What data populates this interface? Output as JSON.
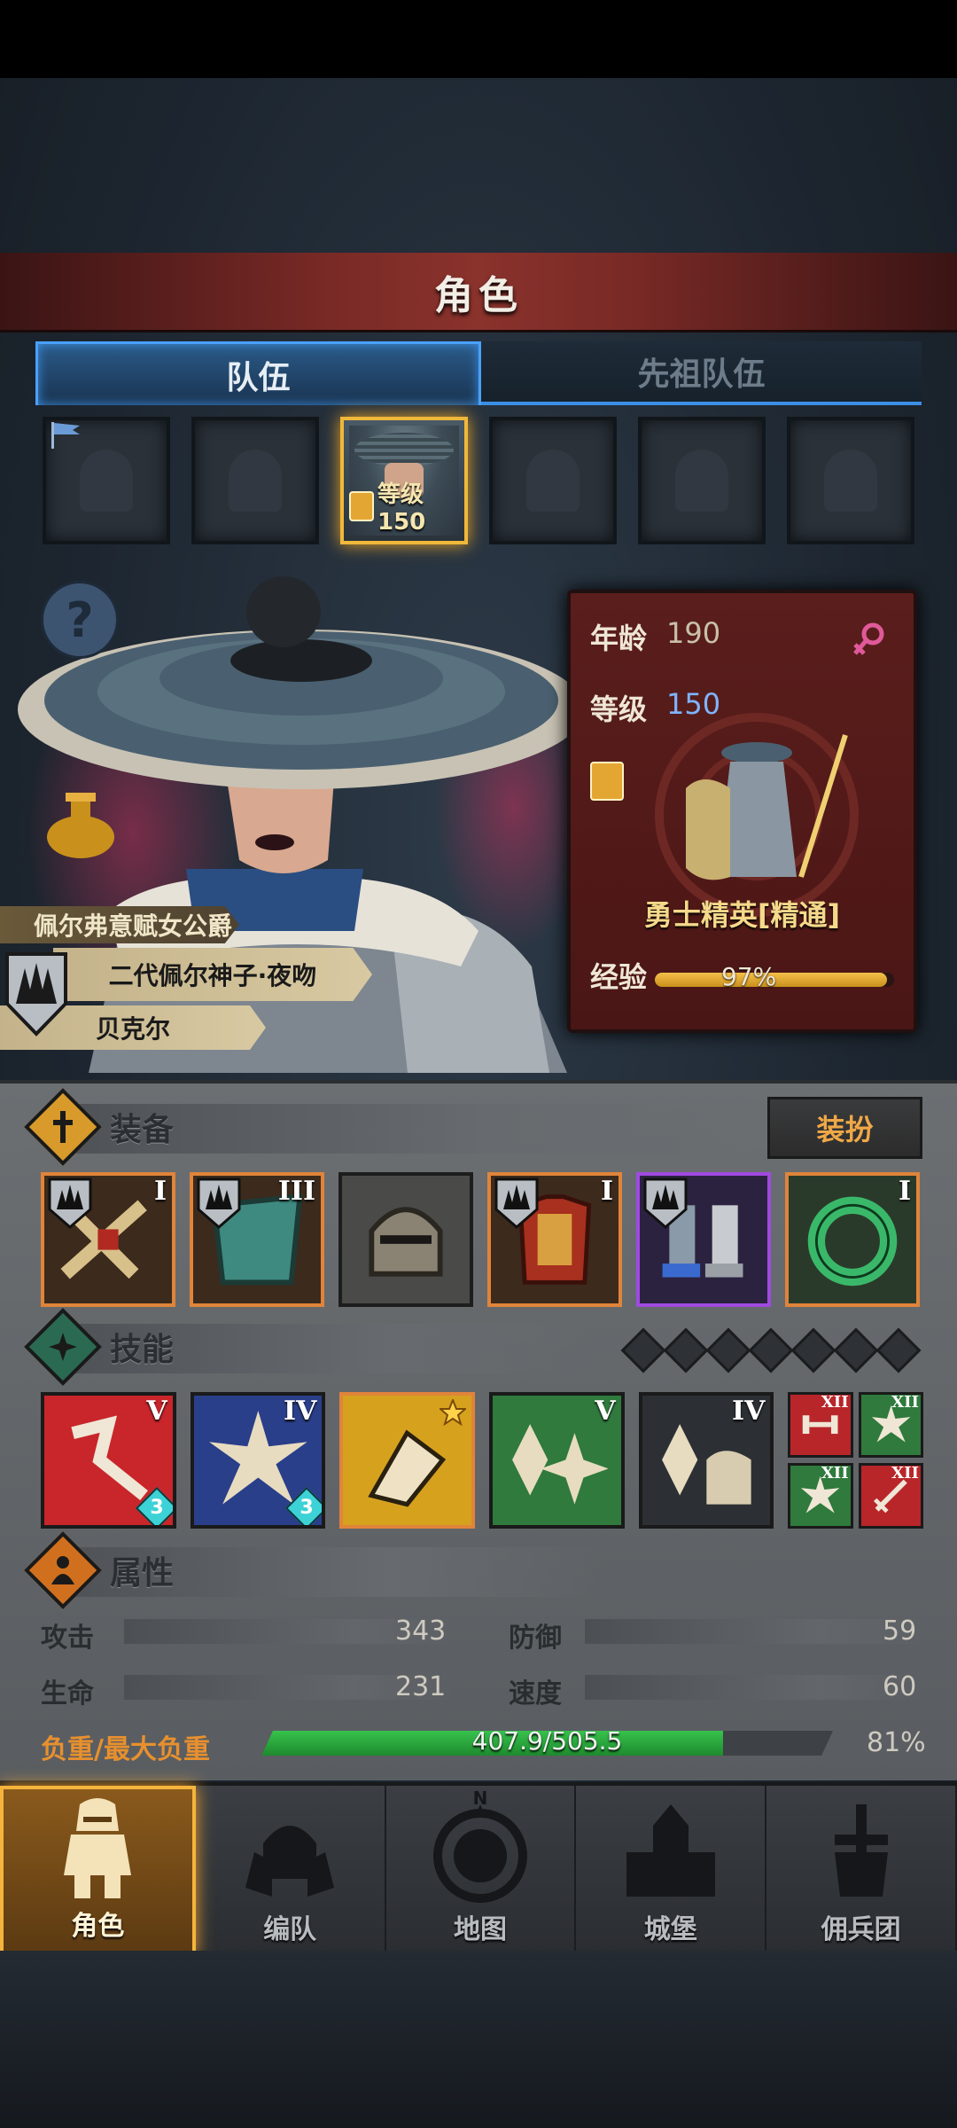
{
  "header": {
    "title": "角色"
  },
  "tabs": [
    {
      "label": "队伍",
      "active": true
    },
    {
      "label": "先祖队伍",
      "active": false
    }
  ],
  "team": {
    "selected_slot": 3,
    "selected_level_label": "等级150"
  },
  "hero": {
    "title": "佩尔弗意赋女公爵",
    "epithet": "二代佩尔神子·夜吻",
    "name": "贝克尔",
    "age_label": "年龄",
    "age": "190",
    "level_label": "等级",
    "level": "150",
    "class_name": "勇士精英[精通]",
    "exp_label": "经验",
    "exp_pct_text": "97%",
    "exp_fraction": 0.97
  },
  "equipment": {
    "title": "装备",
    "dress_button": "装扮",
    "items": [
      {
        "name": "weapon",
        "tier": "I",
        "rarity": "orange"
      },
      {
        "name": "shield",
        "tier": "III",
        "rarity": "orange"
      },
      {
        "name": "helmet",
        "tier": "",
        "rarity": "plain"
      },
      {
        "name": "armor",
        "tier": "I",
        "rarity": "orange"
      },
      {
        "name": "boots",
        "tier": "",
        "rarity": "purple"
      },
      {
        "name": "ring",
        "tier": "I",
        "rarity": "orange"
      }
    ]
  },
  "skills": {
    "title": "技能",
    "gem_count": 7,
    "items": [
      {
        "tier": "V",
        "count": "3",
        "color": "#c8262a"
      },
      {
        "tier": "IV",
        "count": "3",
        "color": "#2a3f8a"
      },
      {
        "tier": "",
        "count": "",
        "color": "#d6a21e"
      },
      {
        "tier": "V",
        "count": "",
        "color": "#2f7a3c"
      },
      {
        "tier": "IV",
        "count": "",
        "color": "#2c3034"
      }
    ],
    "passives": [
      {
        "tier": "XII",
        "color": "#b8262a"
      },
      {
        "tier": "XII",
        "color": "#2f7a3c"
      },
      {
        "tier": "XII",
        "color": "#2f7a3c"
      },
      {
        "tier": "XII",
        "color": "#b8262a"
      }
    ]
  },
  "attributes": {
    "title": "属性",
    "attack_label": "攻击",
    "attack": "343",
    "defense_label": "防御",
    "defense": "59",
    "hp_label": "生命",
    "hp": "231",
    "speed_label": "速度",
    "speed": "60",
    "load_label": "负重/最大负重",
    "load_text": "407.9/505.5",
    "load_pct": "81%",
    "load_fraction": 0.807
  },
  "nav": [
    {
      "label": "角色",
      "active": true
    },
    {
      "label": "编队",
      "active": false
    },
    {
      "label": "地图",
      "active": false
    },
    {
      "label": "城堡",
      "active": false
    },
    {
      "label": "佣兵团",
      "active": false
    }
  ],
  "nav_compass_n": "N"
}
